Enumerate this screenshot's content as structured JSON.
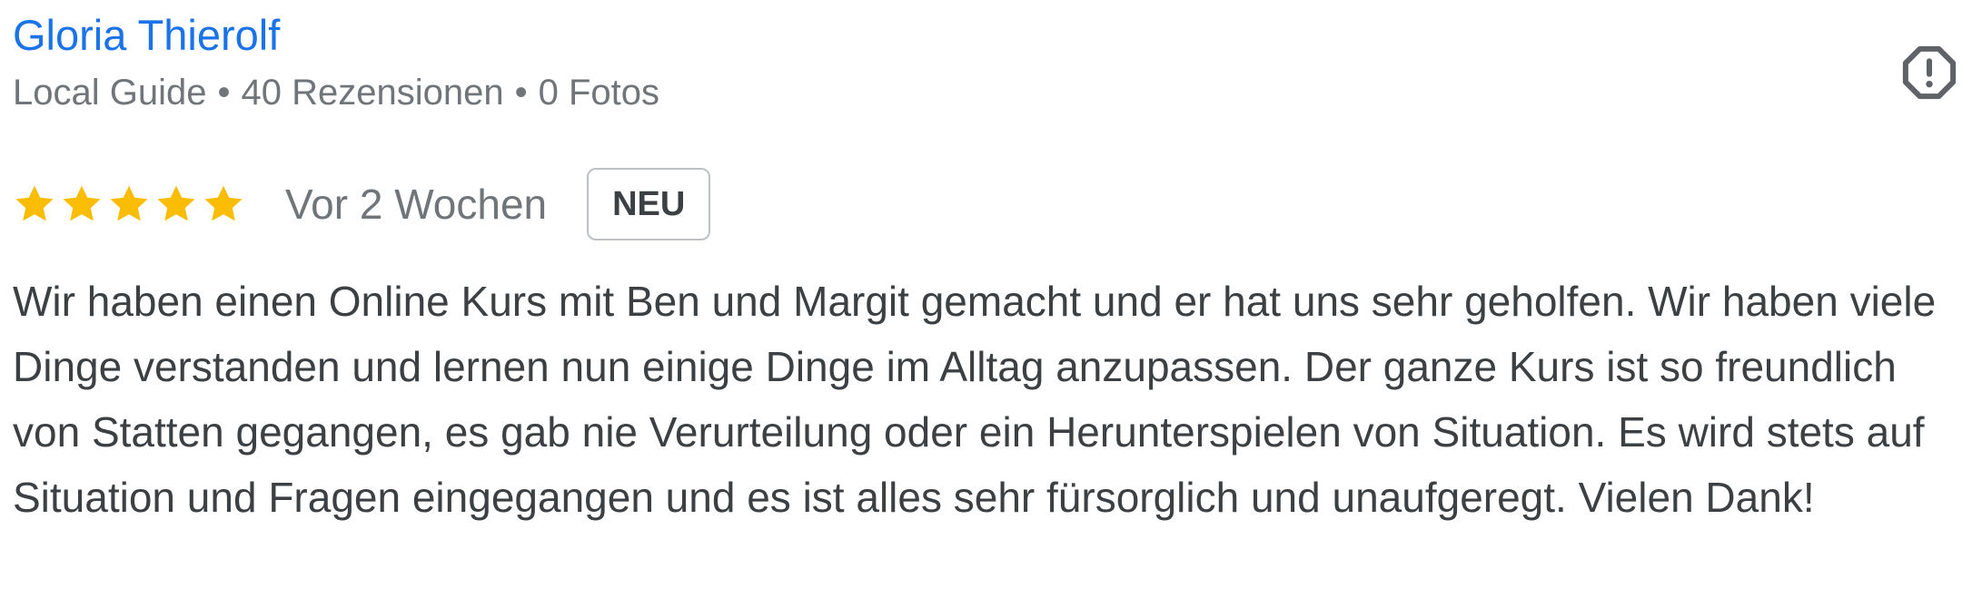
{
  "review": {
    "author": {
      "name": "Gloria Thierolf",
      "guide_label": "Local Guide",
      "separator": "•",
      "reviews_count": "40 Rezensionen",
      "photos_count": "0 Fotos"
    },
    "rating": {
      "stars": 5,
      "max_stars": 5,
      "star_color": "#fbbc04"
    },
    "age": "Vor 2 Wochen",
    "badge": "NEU",
    "text": "Wir haben einen Online Kurs mit Ben und Margit gemacht und er hat uns sehr geholfen. Wir haben viele Dinge verstanden und lernen nun einige Dinge im Alltag anzupassen. Der ganze Kurs ist so freundlich von Statten gegangen, es gab nie Verurteilung oder ein Herunterspielen von Situation. Es wird stets auf Situation und Fragen eingegangen und es ist alles sehr fürsorglich und unaufgeregt. Vielen Dank!"
  },
  "icons": {
    "report": "report-octagon-icon",
    "star": "star-icon"
  },
  "colors": {
    "link": "#1a73e8",
    "meta": "#70757a",
    "text": "#3c4043",
    "star": "#fbbc04",
    "badge_border": "#bdc1c6"
  }
}
